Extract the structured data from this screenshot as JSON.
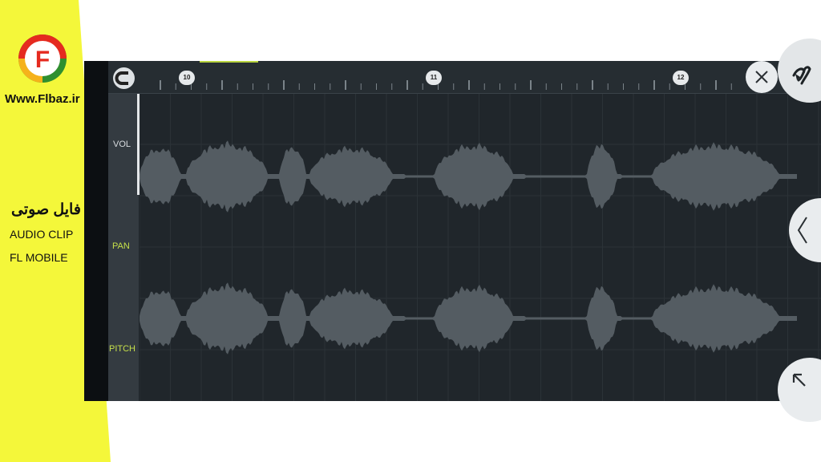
{
  "brand": {
    "site": "Www.Flbaz.ir",
    "title_fa": "فایل صوتی",
    "tag1": "AUDIO CLIP",
    "tag2": "FL MOBILE",
    "logo_letter": "F",
    "banner_color": "#f4f73a"
  },
  "timeline": {
    "markers": [
      "10",
      "11",
      "12"
    ],
    "accent": "#b9d540"
  },
  "sidebar": {
    "vol": "VOL",
    "pan": "PAN",
    "pitch": "PITCH"
  },
  "icons": {
    "snap": "magnet-icon",
    "close": "close-icon",
    "mascot": "fl-fruit-icon",
    "back": "chevron-left-icon",
    "resize": "resize-arrow-icon"
  }
}
